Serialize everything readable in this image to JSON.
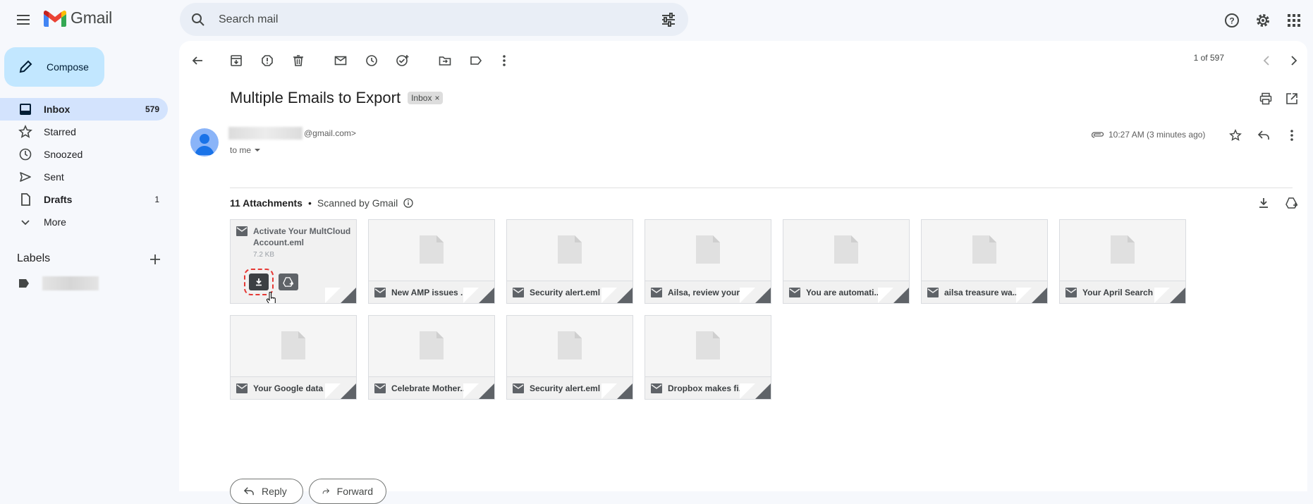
{
  "app": {
    "name": "Gmail"
  },
  "search": {
    "placeholder": "Search mail"
  },
  "compose": {
    "label": "Compose"
  },
  "nav": [
    {
      "label": "Inbox",
      "count": "579",
      "icon": "inbox-icon"
    },
    {
      "label": "Starred",
      "count": "",
      "icon": "star-icon"
    },
    {
      "label": "Snoozed",
      "count": "",
      "icon": "clock-icon"
    },
    {
      "label": "Sent",
      "count": "",
      "icon": "send-icon"
    },
    {
      "label": "Drafts",
      "count": "1",
      "icon": "draft-icon"
    },
    {
      "label": "More",
      "count": "",
      "icon": "chevron-down-icon"
    }
  ],
  "labels": {
    "title": "Labels"
  },
  "pager": {
    "text": "1 of 597"
  },
  "email": {
    "subject": "Multiple Emails to Export",
    "chip": "Inbox",
    "sender_domain": "@gmail.com>",
    "to": "to me",
    "time": "10:27 AM (3 minutes ago)"
  },
  "attachments": {
    "count_label": "11 Attachments",
    "scanned": "Scanned by Gmail",
    "first": {
      "name": "Activate Your MultCloud Account.eml",
      "size": "7.2 KB"
    },
    "items": [
      "New AMP issues ...",
      "Security alert.eml",
      "Ailsa, review your...",
      "You are automati...",
      "ailsa treasure wa...",
      "Your April Search ...",
      "Your Google data ...",
      "Celebrate Mother...",
      "Security alert.eml",
      "Dropbox makes fi..."
    ]
  },
  "actions": {
    "reply": "Reply",
    "forward": "Forward"
  },
  "colors": {
    "accent": "#c2e7ff",
    "active_nav": "#d3e3fd",
    "background": "#f6f8fc",
    "highlight": "#e53935"
  }
}
